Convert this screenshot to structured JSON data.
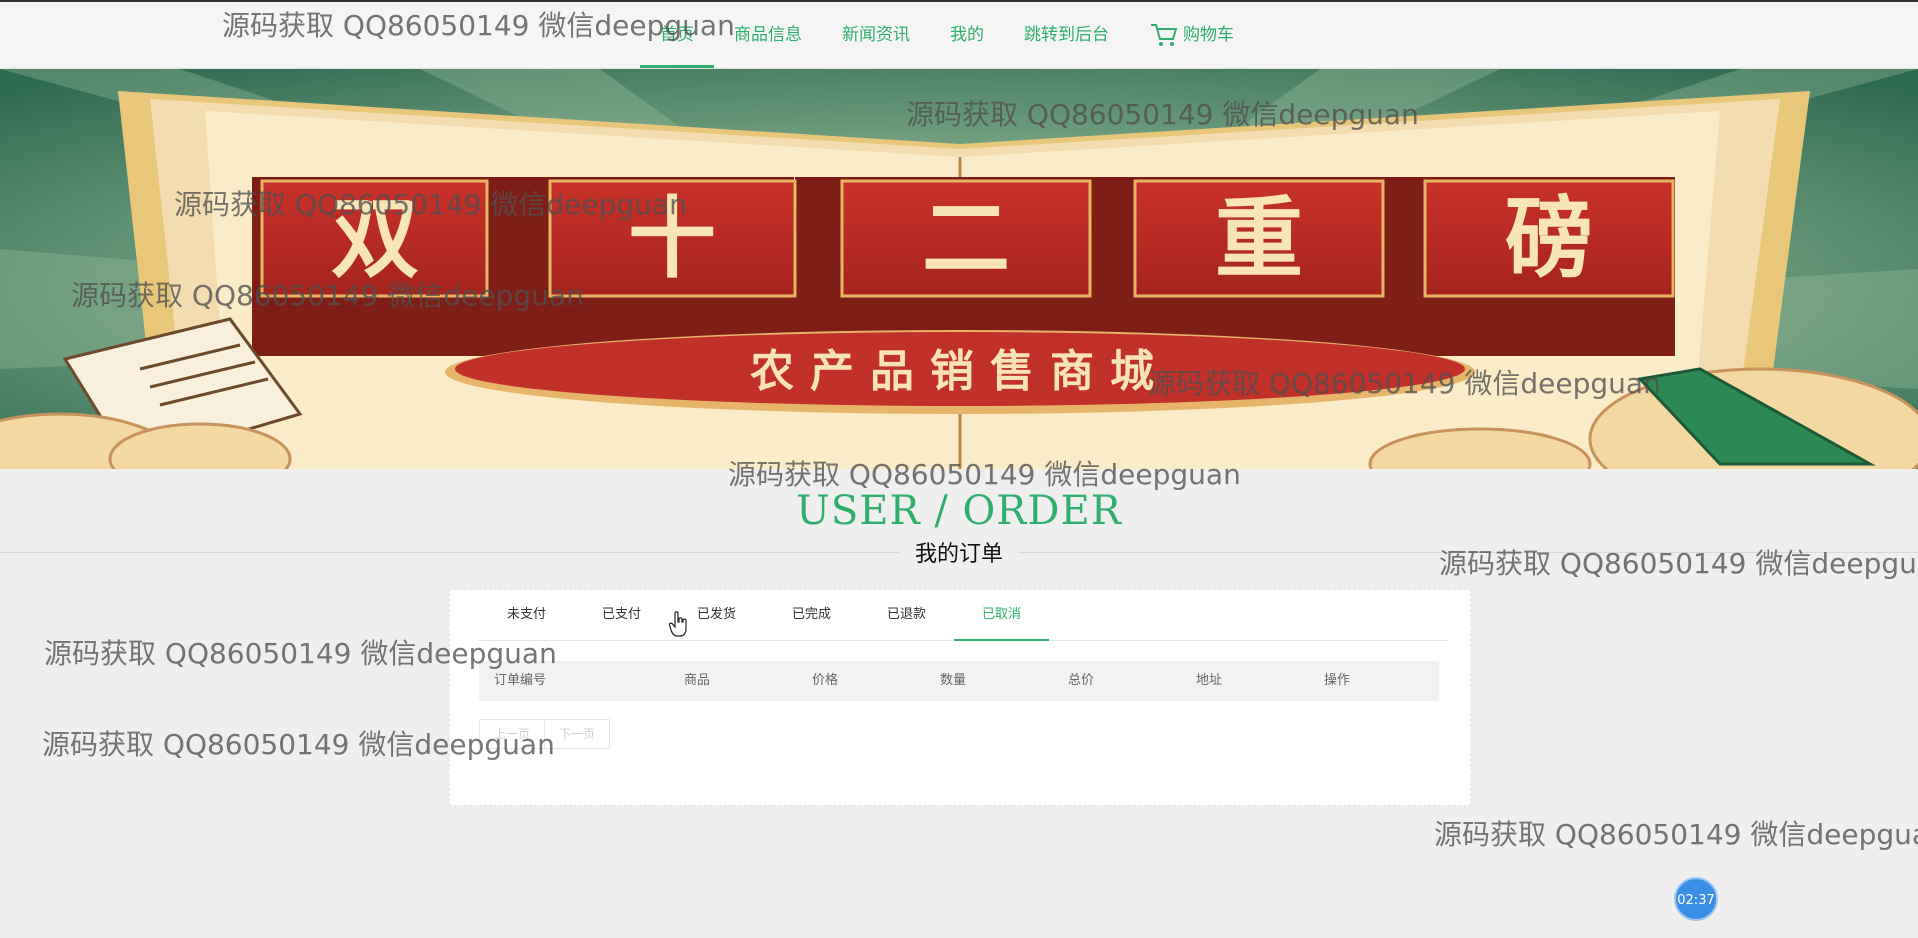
{
  "nav": {
    "items": [
      {
        "label": "首页",
        "active": true
      },
      {
        "label": "商品信息"
      },
      {
        "label": "新闻资讯"
      },
      {
        "label": "我的"
      },
      {
        "label": "跳转到后台"
      }
    ],
    "cart_label": "购物车",
    "cart_icon": "cart-icon",
    "accent_color": "#2fae6e"
  },
  "banner": {
    "headline_chars": [
      "双",
      "十",
      "二",
      "重",
      "磅"
    ],
    "subtitle": "农产品销售商城"
  },
  "section": {
    "title": "USER / ORDER",
    "subtitle": "我的订单"
  },
  "orders": {
    "tabs": [
      "未支付",
      "已支付",
      "已发货",
      "已完成",
      "已退款",
      "已取消"
    ],
    "active_tab": "已取消",
    "columns": [
      "订单编号",
      "商品",
      "价格",
      "数量",
      "总价",
      "地址",
      "操作"
    ],
    "rows": [],
    "prev_label": "上一页",
    "next_label": "下一页"
  },
  "timer": "02:37",
  "watermark": "源码获取 QQ86050149 微信deepguan"
}
